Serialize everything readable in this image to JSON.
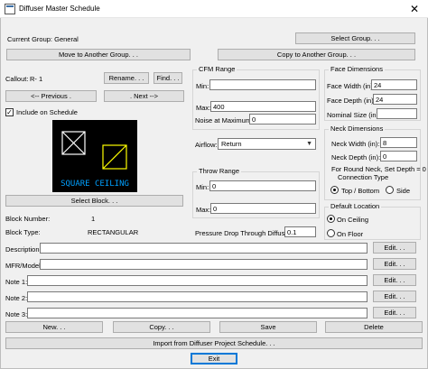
{
  "window": {
    "title": "Diffuser Master Schedule",
    "close_glyph": "✕"
  },
  "group": {
    "current_label": "Current Group:",
    "current_value": "General",
    "select_group": "Select Group. . .",
    "move_to_group": "Move to Another Group. . .",
    "copy_to_group": "Copy to Another Group. . ."
  },
  "callout": {
    "label": "Callout:",
    "value": "R- 1",
    "rename": "Rename. . .",
    "find": "Find. . ."
  },
  "nav": {
    "previous": "<-- Previous .",
    "next": ". Next -->"
  },
  "include_schedule": {
    "label": "Include on Schedule",
    "checked": true,
    "check_glyph": "✓"
  },
  "preview": {
    "text": "SQUARE CEILING",
    "line_color": "#ffffff",
    "accent_color": "#ffff00",
    "text_color": "#00a0ff"
  },
  "block": {
    "select": "Select Block. . .",
    "number_label": "Block Number:",
    "number_value": "1",
    "type_label": "Block Type:",
    "type_value": "RECTANGULAR"
  },
  "cfm": {
    "title": "CFM Range",
    "min_label": "Min:",
    "min_value": "",
    "max_label": "Max:",
    "max_value": "400",
    "noise_label": "Noise at Maximum:",
    "noise_value": "0"
  },
  "airflow": {
    "label": "Airflow:",
    "value": "Return",
    "arrow": "▼"
  },
  "throw": {
    "title": "Throw Range",
    "min_label": "Min:",
    "min_value": "0",
    "max_label": "Max:",
    "max_value": "0"
  },
  "pressure": {
    "label": "Pressure Drop Through Diffuser:",
    "value": "0.1"
  },
  "face": {
    "title": "Face Dimensions",
    "width_label": "Face Width (in):",
    "width_value": "24",
    "depth_label": "Face Depth (in):",
    "depth_value": "24",
    "nominal_label": "Nominal Size (in):",
    "nominal_value": ""
  },
  "neck": {
    "title": "Neck Dimensions",
    "width_label": "Neck Width (in):",
    "width_value": "8",
    "depth_label": "Neck Depth (in):",
    "depth_value": "0",
    "note": "For Round Neck, Set Depth = 0",
    "connection_label": "Connection Type",
    "top_bottom": "Top / Bottom",
    "side": "Side",
    "selected": "top_bottom"
  },
  "location": {
    "title": "Default Location",
    "on_ceiling": "On Ceiling",
    "on_floor": "On Floor",
    "selected": "on_ceiling"
  },
  "fields": [
    {
      "label": "Description:",
      "value": "",
      "edit": "Edit. . ."
    },
    {
      "label": "MFR/Model:",
      "value": "",
      "edit": "Edit. . ."
    },
    {
      "label": "Note 1:",
      "value": "",
      "edit": "Edit. . ."
    },
    {
      "label": "Note 2:",
      "value": "",
      "edit": "Edit. . ."
    },
    {
      "label": "Note 3:",
      "value": "",
      "edit": "Edit. . ."
    }
  ],
  "actions": {
    "new": "New. . .",
    "copy": "Copy. . .",
    "save": "Save",
    "delete": "Delete",
    "import": "Import from Diffuser Project Schedule. . .",
    "exit": "Exit"
  }
}
